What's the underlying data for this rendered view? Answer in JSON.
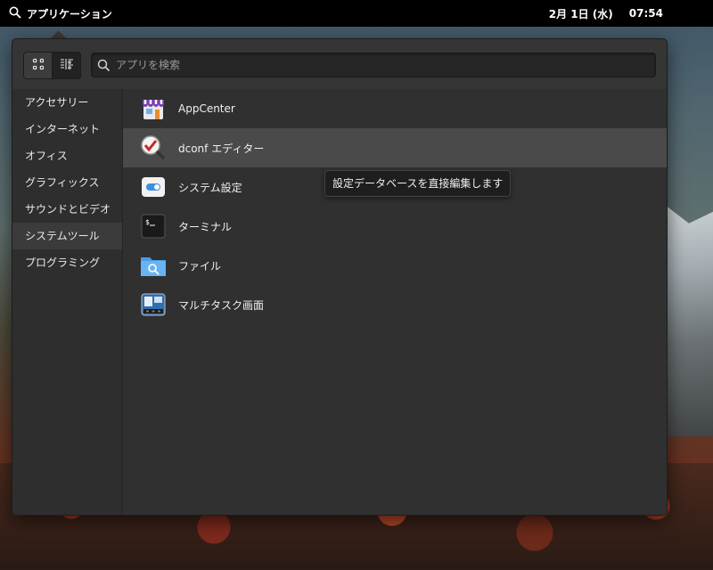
{
  "panel": {
    "apps_label": "アプリケーション",
    "date": "2月 1日 (水)",
    "time": "07:54"
  },
  "search": {
    "placeholder": "アプリを検索",
    "value": ""
  },
  "view_modes": [
    {
      "name": "grid-view",
      "active": false
    },
    {
      "name": "category-view",
      "active": true
    }
  ],
  "categories": [
    {
      "label": "アクセサリー",
      "selected": false
    },
    {
      "label": "インターネット",
      "selected": false
    },
    {
      "label": "オフィス",
      "selected": false
    },
    {
      "label": "グラフィックス",
      "selected": false
    },
    {
      "label": "サウンドとビデオ",
      "selected": false
    },
    {
      "label": "システムツール",
      "selected": true
    },
    {
      "label": "プログラミング",
      "selected": false
    }
  ],
  "apps": [
    {
      "label": "AppCenter",
      "icon": "appcenter-icon"
    },
    {
      "label": "dconf エディター",
      "icon": "dconf-editor-icon",
      "hovered": true
    },
    {
      "label": "システム設定",
      "icon": "settings-toggle-icon"
    },
    {
      "label": "ターミナル",
      "icon": "terminal-icon"
    },
    {
      "label": "ファイル",
      "icon": "files-folder-icon"
    },
    {
      "label": "マルチタスク画面",
      "icon": "multitasking-icon"
    }
  ],
  "tooltip": {
    "text": "設定データベースを直接編集します"
  },
  "colors": {
    "panel_bg": "#000000",
    "popover_bg": "#303030",
    "hover_row": "#4a4a4a",
    "selected_category": "#3b3b3b",
    "accent_blue": "#3d8fe0"
  }
}
